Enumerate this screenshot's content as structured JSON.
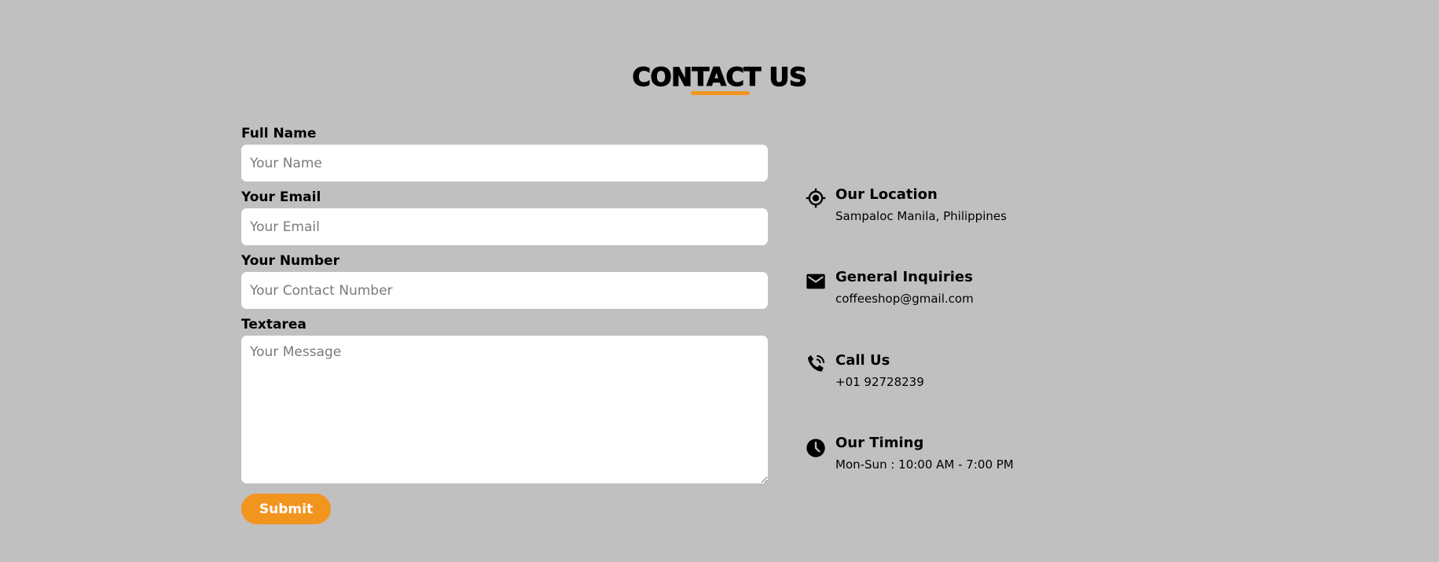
{
  "header": {
    "title": "CONTACT US"
  },
  "form": {
    "full_name_label": "Full Name",
    "full_name_placeholder": "Your Name",
    "email_label": "Your Email",
    "email_placeholder": "Your Email",
    "number_label": "Your Number",
    "number_placeholder": "Your Contact Number",
    "textarea_label": "Textarea",
    "textarea_placeholder": "Your Message",
    "submit_label": "Submit"
  },
  "contact_info": {
    "location": {
      "icon": "location-crosshair-icon",
      "title": "Our Location",
      "text": "Sampaloc Manila, Philippines"
    },
    "inquiries": {
      "icon": "envelope-icon",
      "title": "General Inquiries",
      "text": "coffeeshop@gmail.com"
    },
    "call": {
      "icon": "phone-ringing-icon",
      "title": "Call Us",
      "text": "+01 92728239"
    },
    "timing": {
      "icon": "clock-icon",
      "title": "Our Timing",
      "text": "Mon-Sun : 10:00 AM - 7:00 PM"
    }
  },
  "colors": {
    "background": "#c0c0c0",
    "accent": "#f2951f",
    "input_background": "#ffffff",
    "text": "#000000"
  }
}
